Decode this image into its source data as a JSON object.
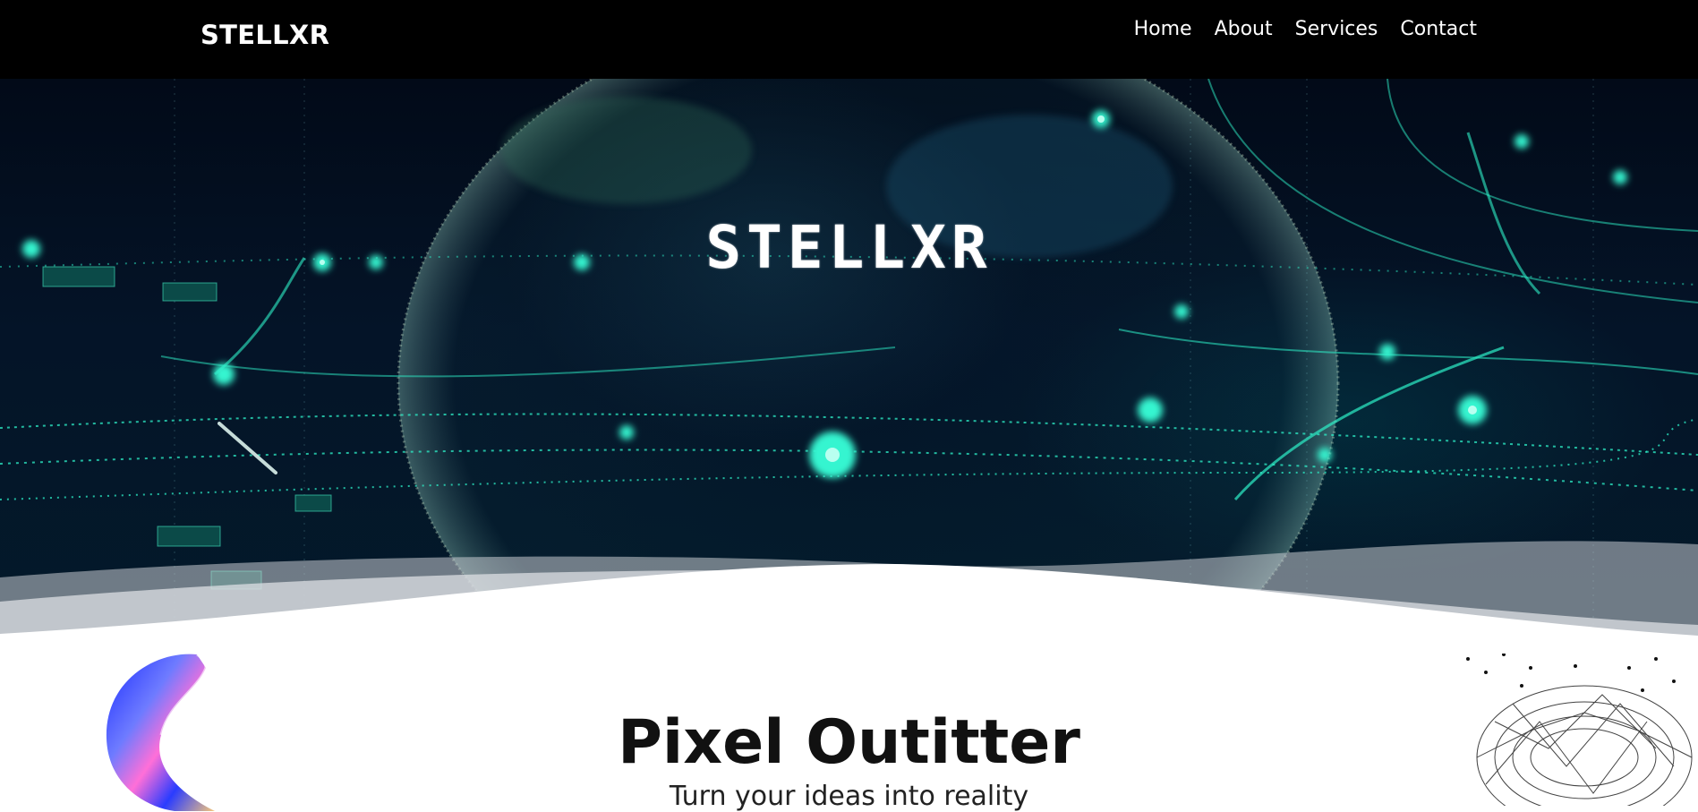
{
  "navbar": {
    "brand": "STELLXR",
    "links": [
      "Home",
      "About",
      "Services",
      "Contact"
    ]
  },
  "hero": {
    "title": "STELLXR"
  },
  "section": {
    "title": "Pixel Outitter",
    "subtitle": "Turn your ideas into reality"
  },
  "colors": {
    "navbar_bg": "#000000",
    "hero_glow": "#2ef0c8",
    "page_bg": "#ffffff"
  },
  "icons": {
    "left_decoration": "holographic-ribbon-3d-shape",
    "right_decoration": "wireframe-torus-shape"
  }
}
